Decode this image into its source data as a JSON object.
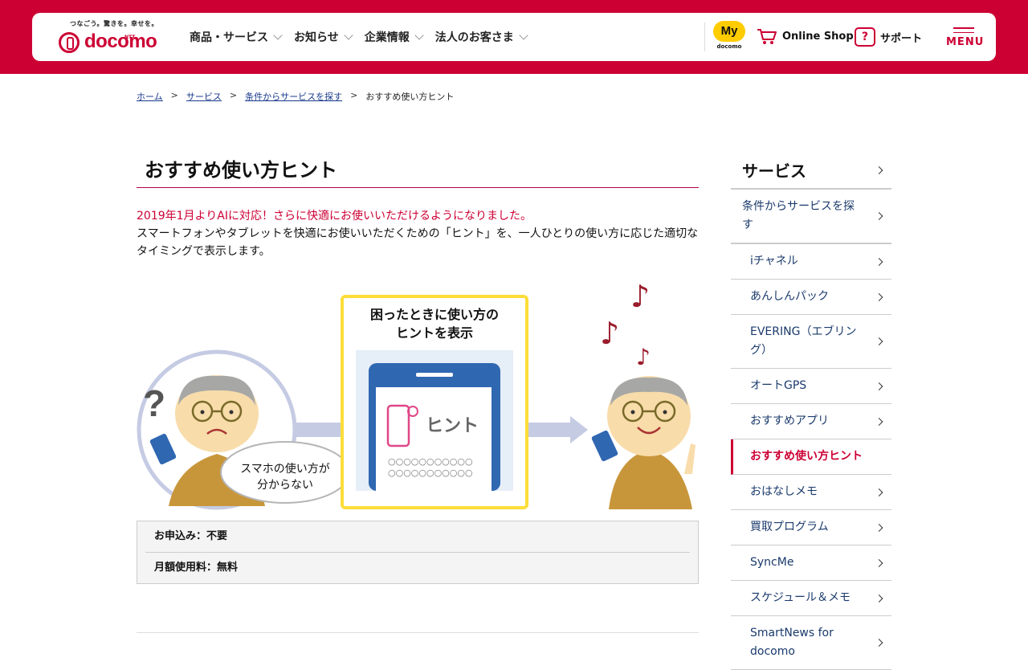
{
  "header": {
    "tagline": "つなごう。驚きを。幸せを。",
    "ntt": "NTT",
    "logo_text": "docomo",
    "nav": [
      {
        "label": "商品・サービス"
      },
      {
        "label": "お知らせ"
      },
      {
        "label": "企業情報"
      },
      {
        "label": "法人のお客さま"
      }
    ],
    "my_label": "My",
    "my_sub": "docomo",
    "online_shop": "Online Shop",
    "support_glyph": "?",
    "support": "サポート",
    "menu": "MENU",
    "brand_color": "#cc0033"
  },
  "breadcrumb": {
    "items": [
      "ホーム",
      "サービス",
      "条件からサービスを探す"
    ],
    "separator": ">",
    "current": "おすすめ使い方ヒント"
  },
  "main": {
    "title": "おすすめ使い方ヒント",
    "lead_red": "2019年1月よりAIに対応！さらに快適にお使いいただけるようになりました。",
    "lead_text": "スマートフォンやタブレットを快適にお使いいただくための「ヒント」を、一人ひとりの使い方に応じた適切なタイミングで表示します。",
    "illustration": {
      "box_title_1": "困ったときに使い方の",
      "box_title_2": "ヒントを表示",
      "hint_label": "ヒント",
      "speech_1": "スマホの使い方が",
      "speech_2": "分からない",
      "question_mark": "?",
      "note_glyph": "♪",
      "dots_row": "○○○○○○○○○○○"
    },
    "info": [
      "お申込み：不要",
      "月額使用料：無料"
    ]
  },
  "sidebar": {
    "title": "サービス",
    "parent": "条件からサービスを探す",
    "items": [
      {
        "label": "iチャネル",
        "active": false
      },
      {
        "label": "あんしんパック",
        "active": false
      },
      {
        "label": "EVERING（エブリング）",
        "active": false
      },
      {
        "label": "オートGPS",
        "active": false
      },
      {
        "label": "おすすめアプリ",
        "active": false
      },
      {
        "label": "おすすめ使い方ヒント",
        "active": true
      },
      {
        "label": "おはなしメモ",
        "active": false
      },
      {
        "label": "買取プログラム",
        "active": false
      },
      {
        "label": "SyncMe",
        "active": false
      },
      {
        "label": "スケジュール＆メモ",
        "active": false
      },
      {
        "label": "SmartNews for docomo",
        "active": false
      }
    ]
  }
}
